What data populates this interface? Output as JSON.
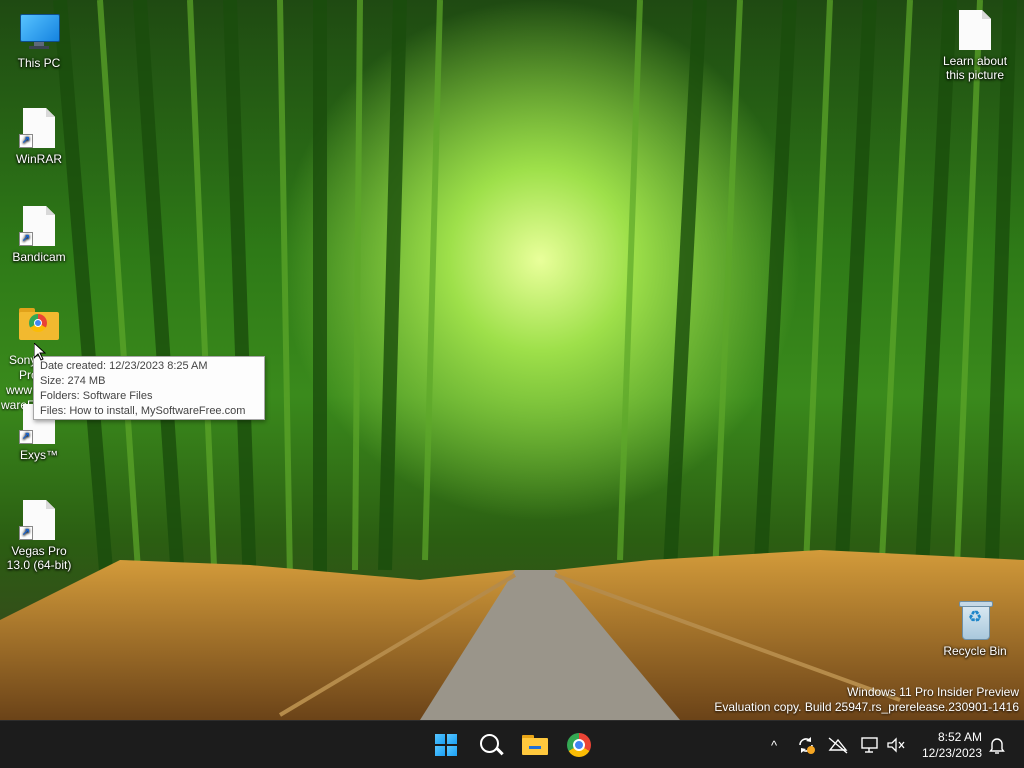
{
  "desktop": {
    "icons_left": [
      {
        "label": "This PC",
        "icon": "this-pc-icon"
      },
      {
        "label": "WinRAR",
        "icon": "shortcut-file-icon"
      },
      {
        "label": "Bandicam",
        "icon": "shortcut-file-icon"
      },
      {
        "label": "Exys™",
        "icon": "shortcut-file-icon"
      },
      {
        "label": "Vegas Pro 13.0 (64-bit)",
        "icon": "shortcut-file-icon"
      }
    ],
    "folder_icon": {
      "icon": "chrome-folder-icon",
      "label_fragments": [
        "Sony",
        "Pro",
        "www",
        "wareF"
      ]
    },
    "learn_about_picture": {
      "label": "Learn about this picture",
      "icon": "file-icon"
    },
    "recycle_bin": {
      "label": "Recycle Bin",
      "icon": "recycle-bin-icon"
    }
  },
  "tooltip": {
    "line1": "Date created: 12/23/2023 8:25 AM",
    "line2": "Size: 274 MB",
    "line3": "Folders: Software Files",
    "line4": "Files: How to install, MySoftwareFree.com"
  },
  "watermark": {
    "line1": "Windows 11 Pro Insider Preview",
    "line2": "Evaluation copy. Build 25947.rs_prerelease.230901-1416"
  },
  "taskbar": {
    "pinned": [
      {
        "name": "start",
        "icon": "windows-logo-icon"
      },
      {
        "name": "search",
        "icon": "search-icon"
      },
      {
        "name": "file-explorer",
        "icon": "folder-icon"
      },
      {
        "name": "chrome",
        "icon": "chrome-icon"
      }
    ],
    "tray_icons": [
      "chevron-up-icon",
      "sync-icon",
      "network-off-icon",
      "display-icon",
      "volume-muted-icon"
    ],
    "chevron": "^",
    "clock": {
      "time": "8:52 AM",
      "date": "12/23/2023"
    },
    "notification_icon": "bell-icon"
  }
}
